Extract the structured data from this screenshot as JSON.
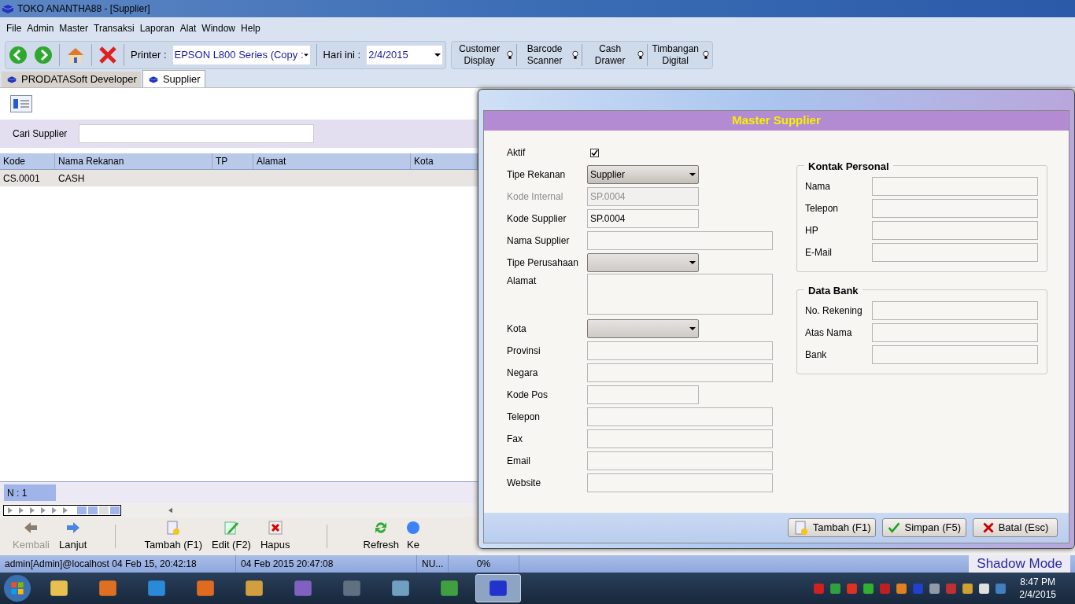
{
  "window": {
    "title": "TOKO ANANTHA88 - [Supplier]"
  },
  "menu": [
    "File",
    "Admin",
    "Master",
    "Transaksi",
    "Laporan",
    "Alat",
    "Window",
    "Help"
  ],
  "toolbar": {
    "printer_label": "Printer :",
    "printer": "EPSON L800 Series (Copy :",
    "date_label": "Hari ini :",
    "date": "2/4/2015",
    "devices": [
      {
        "label": "Customer Display"
      },
      {
        "label": "Barcode Scanner"
      },
      {
        "label": "Cash Drawer"
      },
      {
        "label": "Timbangan Digital"
      }
    ]
  },
  "tabs": [
    {
      "label": "PRODATASoft Developer",
      "selected": false
    },
    {
      "label": "Supplier",
      "selected": true
    }
  ],
  "search": {
    "label": "Cari Supplier"
  },
  "table": {
    "columns": [
      "Kode",
      "Nama Rekanan",
      "TP",
      "Alamat",
      "Kota"
    ],
    "rows": [
      [
        "CS.0001",
        "CASH",
        "",
        "",
        ""
      ]
    ]
  },
  "count": "N : 1",
  "actions": [
    {
      "label": "Kembali",
      "disabled": true
    },
    {
      "label": "Lanjut",
      "disabled": false
    },
    {
      "label": "Tambah (F1)",
      "disabled": false
    },
    {
      "label": "Edit (F2)",
      "disabled": false
    },
    {
      "label": "Hapus",
      "disabled": false
    },
    {
      "label": "Refresh",
      "disabled": false
    },
    {
      "label": "Ke",
      "disabled": false
    }
  ],
  "status_bar": [
    "admin[Admin]@localhost 04 Feb 15, 20:42:18",
    "04 Feb 2015 20:47:08",
    "NU...",
    "0%"
  ],
  "dialog": {
    "title": "Master Supplier",
    "fields": [
      {
        "kind": "checkbox",
        "label": "Aktif",
        "checked": true
      },
      {
        "kind": "dropdown",
        "label": "Tipe Rekanan",
        "value": "Supplier"
      },
      {
        "kind": "shortfield",
        "label": "Kode Internal",
        "value": "SP.0004",
        "disabled": true
      },
      {
        "kind": "shortfield",
        "label": "Kode Supplier",
        "value": "SP.0004",
        "disabled": false
      },
      {
        "kind": "field",
        "label": "Nama Supplier",
        "disabled": false
      },
      {
        "kind": "dropdown",
        "label": "Tipe Perusahaan"
      },
      {
        "kind": "textarea",
        "label": "Alamat"
      },
      {
        "kind": "dropdown",
        "label": "Kota"
      },
      {
        "kind": "field",
        "label": "Provinsi",
        "disabled": false
      },
      {
        "kind": "field",
        "label": "Negara",
        "disabled": false
      },
      {
        "kind": "shortfield",
        "label": "Kode Pos",
        "disabled": false
      },
      {
        "kind": "field",
        "label": "Telepon",
        "disabled": false
      },
      {
        "kind": "field",
        "label": "Fax",
        "disabled": false
      },
      {
        "kind": "field",
        "label": "Email",
        "disabled": false
      },
      {
        "kind": "field",
        "label": "Website",
        "disabled": false
      }
    ],
    "groups": [
      {
        "title": "Kontak Personal",
        "fields": [
          "Nama",
          "Telepon",
          "HP",
          "E-Mail"
        ]
      },
      {
        "title": "Data Bank",
        "fields": [
          "No. Rekening",
          "Atas Nama",
          "Bank"
        ]
      }
    ],
    "buttons": [
      "Tambah (F1)",
      "Simpan (F5)",
      "Batal (Esc)"
    ]
  },
  "shadow_mode": "Shadow Mode",
  "taskbar": {
    "apps": [
      {
        "selected": false
      },
      {
        "selected": false
      },
      {
        "selected": false
      },
      {
        "selected": false
      },
      {
        "selected": false
      },
      {
        "selected": false
      },
      {
        "selected": false
      },
      {
        "selected": false
      },
      {
        "selected": false
      },
      {
        "selected": true
      }
    ],
    "time": "8:47 PM",
    "date": "2/4/2015"
  }
}
